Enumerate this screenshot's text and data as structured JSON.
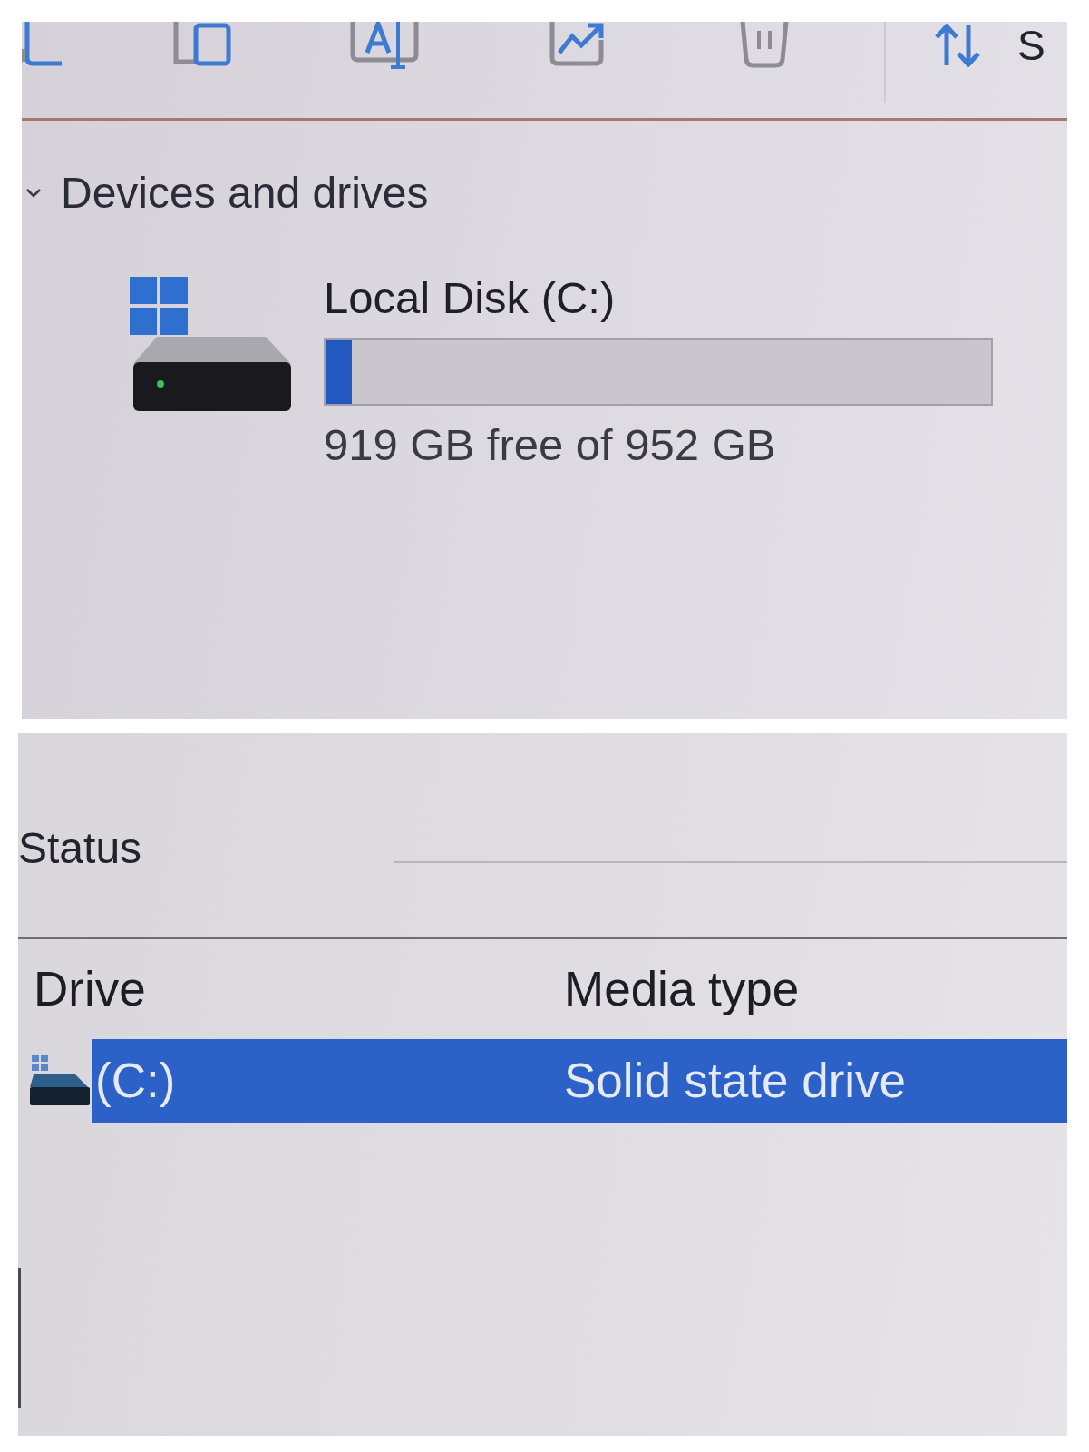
{
  "toolbar": {
    "sort_label": "S"
  },
  "devices": {
    "title": "Devices and drives",
    "expanded": true,
    "drives": [
      {
        "name": "Local Disk (C:)",
        "level": 0.04,
        "free_text": "919 GB free of 952 GB"
      }
    ]
  },
  "status": {
    "title": "Status"
  },
  "table": {
    "columns": [
      "Drive",
      "Media type"
    ],
    "rows": [
      {
        "drive": "(C:)",
        "media_type": "Solid state drive",
        "selected": true
      }
    ]
  }
}
